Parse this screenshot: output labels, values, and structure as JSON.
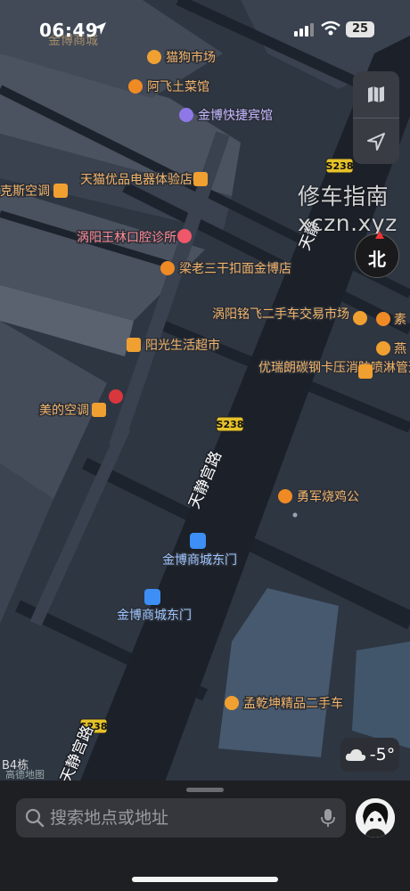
{
  "status": {
    "time": "06:49",
    "battery": "25"
  },
  "map": {
    "road_labels": [
      "天静宫路",
      "天静宫路",
      "天静"
    ],
    "route_shields": [
      "S238",
      "S238",
      "S238"
    ],
    "pois": [
      {
        "name": "猫狗市场",
        "icon": "basket-icon",
        "color": "#f0a030"
      },
      {
        "name": "阿飞土菜馆",
        "icon": "fork-knife-icon",
        "color": "#f08a24"
      },
      {
        "name": "金博快捷宾馆",
        "icon": "bed-icon",
        "color": "#8e78e8"
      },
      {
        "name": "天猫优品电器体验店",
        "icon": "shop-icon",
        "color": "#f0a030"
      },
      {
        "name": "克斯空调",
        "icon": "shop-icon",
        "color": "#f0a030"
      },
      {
        "name": "涡阳王林口腔诊所",
        "icon": "tooth-icon",
        "color": "#f0576a"
      },
      {
        "name": "梁老三干扣面金博店",
        "icon": "fork-knife-icon",
        "color": "#f08a24"
      },
      {
        "name": "阳光生活超市",
        "icon": "shop-icon",
        "color": "#f0a030"
      },
      {
        "name": "美的空调",
        "icon": "shop-icon",
        "color": "#f0a030"
      },
      {
        "name": "涡阳铭飞二手车交易市场",
        "icon": "car-icon",
        "color": "#f0a030"
      },
      {
        "name": "素",
        "icon": "fork-knife-icon",
        "color": "#f08a24"
      },
      {
        "name": "燕",
        "icon": "car-icon",
        "color": "#f0a030"
      },
      {
        "name": "优瑞朗碳钢卡压消防喷淋管道系统",
        "icon": "briefcase-icon",
        "color": "#f0a030"
      },
      {
        "name": "勇军烧鸡公",
        "icon": "fork-knife-icon",
        "color": "#f08a24"
      },
      {
        "name": "金博商城东门",
        "icon": "bus-icon",
        "color": "#3d8ef5"
      },
      {
        "name": "金博商城东门",
        "icon": "bus-icon",
        "color": "#3d8ef5"
      },
      {
        "name": "孟乾坤精品二手车",
        "icon": "car-icon",
        "color": "#f0a030"
      }
    ],
    "top_partial_label": "金博商城",
    "district_label": "B4栋",
    "provider": "高德地图"
  },
  "compass": {
    "label": "北"
  },
  "watermark": {
    "line1": "修车指南",
    "line2": "xczn.xyz"
  },
  "weather": {
    "icon": "cloud-icon",
    "temp": "-5°"
  },
  "search": {
    "placeholder": "搜索地点或地址"
  },
  "colors": {
    "food": "#f08a24",
    "shop": "#f0a030",
    "hotel": "#8e78e8",
    "bus": "#3d8ef5",
    "clinic": "#f0576a"
  }
}
